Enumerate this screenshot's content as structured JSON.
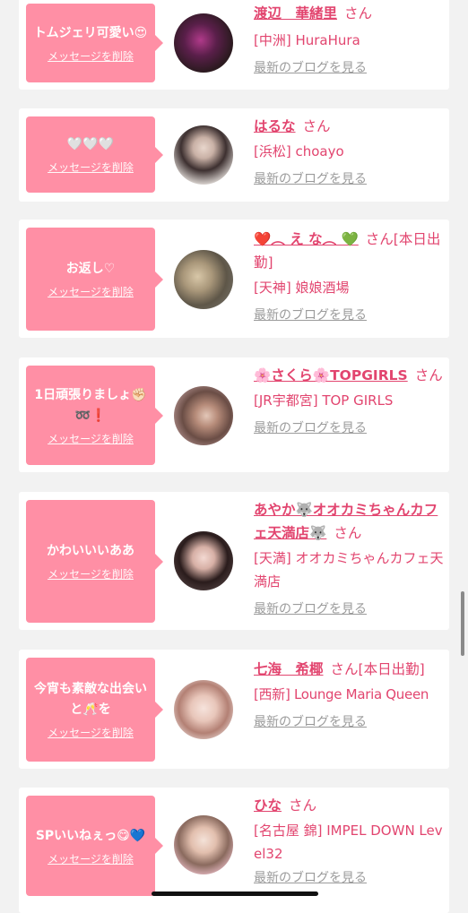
{
  "cards": [
    {
      "message": "トムジェリ可愛い😍",
      "delete_label": "メッセージを削除",
      "name": "渡辺　華緒里",
      "honorific": "さん",
      "shop": "[中洲] HuraHura",
      "blog_label": "最新のブログを見る"
    },
    {
      "message": "🤍🤍🤍",
      "delete_label": "メッセージを削除",
      "name": "はるな",
      "honorific": "さん",
      "shop": "[浜松] choayo",
      "blog_label": "最新のブログを見る"
    },
    {
      "message": "お返し♡",
      "delete_label": "メッセージを削除",
      "name": "❤️︵ え な︵ 💚",
      "honorific": "さん[本日出勤]",
      "shop": "[天神] 娘娘酒場",
      "blog_label": "最新のブログを見る"
    },
    {
      "message": "1日頑張りましょ✊🏻➿❗️",
      "delete_label": "メッセージを削除",
      "name": "🌸さくら🌸TOPGIRLS",
      "honorific": "さん",
      "shop": "[JR宇都宮] TOP GIRLS",
      "blog_label": "最新のブログを見る"
    },
    {
      "message": "かわいいいああ",
      "delete_label": "メッセージを削除",
      "name": "あやか🐺オオカミちゃんカフェ天満店🐺",
      "honorific": "さん",
      "shop": "[天満] オオカミちゃんカフェ天満店",
      "blog_label": "最新のブログを見る"
    },
    {
      "message": "今宵も素敵な出会いと🥂を",
      "delete_label": "メッセージを削除",
      "name": "七海　希椰",
      "honorific": "さん[本日出勤]",
      "shop": "[西新] Lounge Maria Queen",
      "blog_label": "最新のブログを見る"
    },
    {
      "message": "SPいいねぇっ😋💙",
      "delete_label": "メッセージを削除",
      "name": "ひな",
      "honorific": "さん",
      "shop": "[名古屋 錦] IMPEL DOWN Level32",
      "blog_label": "最新のブログを見る"
    }
  ],
  "colors": {
    "bubble": "#ff8fa5",
    "name_text": "#e2456f",
    "blog_link": "#9b9b9b",
    "background": "#f2f2f2"
  }
}
